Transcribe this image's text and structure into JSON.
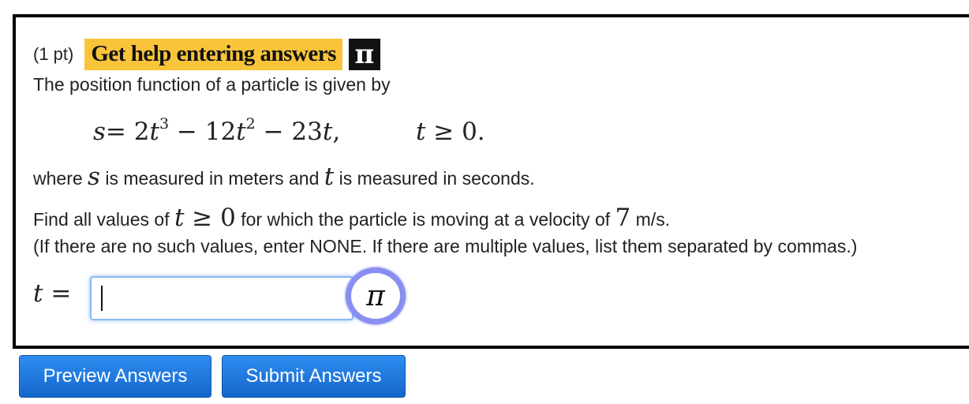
{
  "problem": {
    "points": "(1 pt)",
    "help_link": "Get help entering answers",
    "help_icon": "π",
    "intro": "The position function of a particle is given by",
    "equation": {
      "s": "s",
      "eq_part1": "= 2",
      "t1": "t",
      "exp1": "3",
      "eq_part2": " − 12",
      "t2": "t",
      "exp2": "2",
      "eq_part3": " − 23",
      "t3": "t",
      "eq_part4": ",",
      "cond_t": "t",
      "cond_rest": " ≥ 0."
    },
    "units": {
      "where": "where ",
      "s": "s",
      "mid": " is measured in meters and ",
      "t": "t",
      "end": " is measured in seconds."
    },
    "question": {
      "find": "Find all values of ",
      "t": "t",
      "geq": " ≥ 0",
      "mid": " for which the particle is moving at a velocity of ",
      "seven": "7",
      "end": " m/s."
    },
    "instructions": "(If there are no such values, enter NONE. If there are multiple values, list them separated by commas.)"
  },
  "answer": {
    "label_t": "t",
    "label_eq": " =",
    "value": "",
    "pi_icon": "π"
  },
  "buttons": {
    "preview": "Preview Answers",
    "submit": "Submit Answers"
  },
  "colors": {
    "help_bg": "#f9c43a",
    "button_blue": "#1f7ae0",
    "input_focus": "#8ab8f0",
    "pi_ring": "#8a8ef0"
  }
}
